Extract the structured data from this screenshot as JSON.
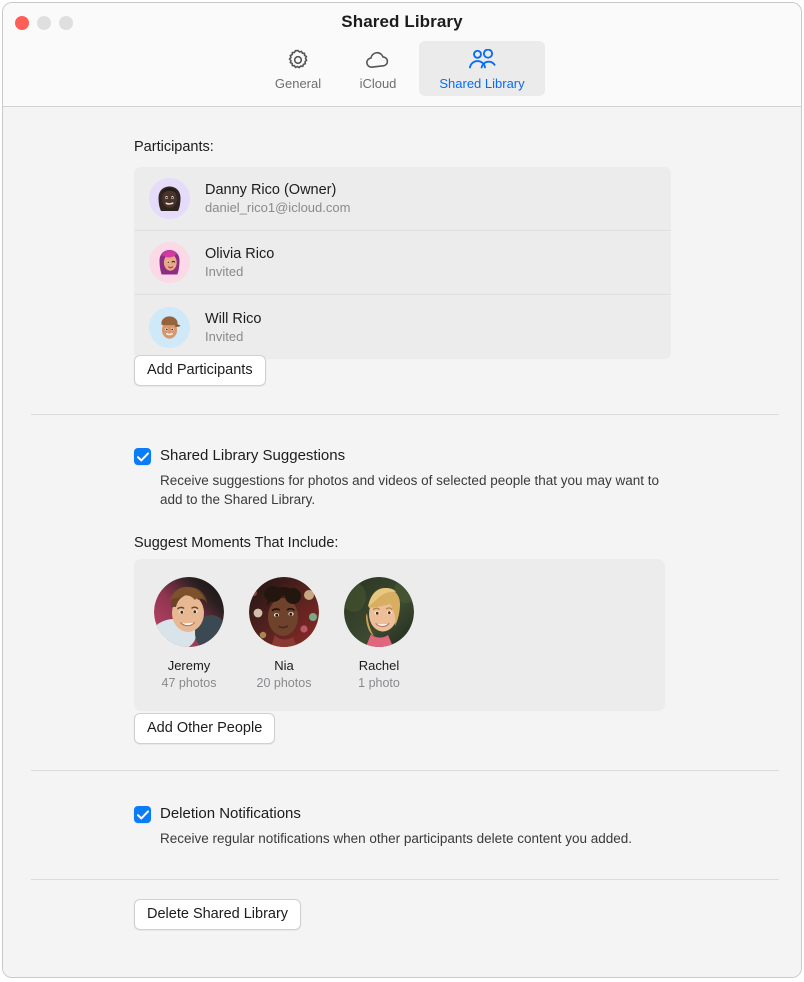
{
  "window": {
    "title": "Shared Library",
    "traffic_lights": [
      "close-button",
      "minimize-button",
      "zoom-button"
    ]
  },
  "toolbar": {
    "items": [
      {
        "label": "General",
        "icon": "gear-icon",
        "selected": false
      },
      {
        "label": "iCloud",
        "icon": "cloud-icon",
        "selected": false
      },
      {
        "label": "Shared Library",
        "icon": "two-people-icon",
        "selected": true
      }
    ],
    "selected_color": "#0a6cf5",
    "label_color": "#6e6e73"
  },
  "participants": {
    "label": "Participants:",
    "rows": [
      {
        "name": "Danny Rico (Owner)",
        "detail": "daniel_rico1@icloud.com",
        "avatar": "memoji-dark-long-hair",
        "avatar_bg": "#e5dcfa"
      },
      {
        "name": "Olivia Rico",
        "detail": "Invited",
        "avatar": "memoji-pink-hair",
        "avatar_bg": "#fcd9e6"
      },
      {
        "name": "Will Rico",
        "detail": "Invited",
        "avatar": "memoji-brown-cap",
        "avatar_bg": "#cfe9f8"
      }
    ],
    "add_button": "Add Participants"
  },
  "suggestions": {
    "checkbox_label": "Shared Library Suggestions",
    "checked": true,
    "description": "Receive suggestions for photos and videos of selected people that you may want to add to the Shared Library.",
    "people_label": "Suggest Moments That Include:",
    "people": [
      {
        "name": "Jeremy",
        "count": "47 photos",
        "photo": "photo-jeremy"
      },
      {
        "name": "Nia",
        "count": "20 photos",
        "photo": "photo-nia"
      },
      {
        "name": "Rachel",
        "count": "1 photo",
        "photo": "photo-rachel"
      }
    ],
    "add_button": "Add Other People"
  },
  "deletion": {
    "checkbox_label": "Deletion Notifications",
    "checked": true,
    "description": "Receive regular notifications when other participants delete content you added."
  },
  "footer": {
    "delete_button": "Delete Shared Library"
  },
  "colors": {
    "accent": "#0a7cf7",
    "window_bg": "#f4f4f4",
    "titlebar_bg": "#fafafa",
    "panel_bg": "#ececec",
    "close_red": "#ff5f57"
  }
}
